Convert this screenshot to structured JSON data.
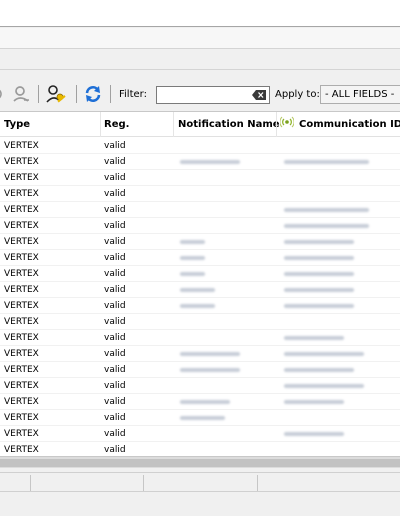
{
  "toolbar": {
    "filter_label": "Filter:",
    "filter_value": "",
    "apply_label": "Apply to:",
    "apply_value": "- ALL FIELDS -"
  },
  "grid": {
    "columns": [
      "Type",
      "Reg.",
      "Notification Name",
      "Communication IDs"
    ],
    "rows": [
      {
        "type": "VERTEX",
        "reg": "valid"
      },
      {
        "type": "VERTEX",
        "reg": "valid"
      },
      {
        "type": "VERTEX",
        "reg": "valid"
      },
      {
        "type": "VERTEX",
        "reg": "valid"
      },
      {
        "type": "VERTEX",
        "reg": "valid"
      },
      {
        "type": "VERTEX",
        "reg": "valid"
      },
      {
        "type": "VERTEX",
        "reg": "valid"
      },
      {
        "type": "VERTEX",
        "reg": "valid"
      },
      {
        "type": "VERTEX",
        "reg": "valid"
      },
      {
        "type": "VERTEX",
        "reg": "valid"
      },
      {
        "type": "VERTEX",
        "reg": "valid"
      },
      {
        "type": "VERTEX",
        "reg": "valid"
      },
      {
        "type": "VERTEX",
        "reg": "valid"
      },
      {
        "type": "VERTEX",
        "reg": "valid"
      },
      {
        "type": "VERTEX",
        "reg": "valid"
      },
      {
        "type": "VERTEX",
        "reg": "valid"
      },
      {
        "type": "VERTEX",
        "reg": "valid"
      },
      {
        "type": "VERTEX",
        "reg": "valid"
      },
      {
        "type": "VERTEX",
        "reg": "valid"
      },
      {
        "type": "VERTEX",
        "reg": "valid"
      }
    ]
  },
  "colors": {
    "refresh_icon": "#1e6fd6",
    "key_icon": "#e0b000",
    "header_text": "#000000"
  },
  "icons": [
    "user-icon",
    "user-key-icon",
    "refresh-icon",
    "clear-input-icon",
    "antenna-icon"
  ]
}
